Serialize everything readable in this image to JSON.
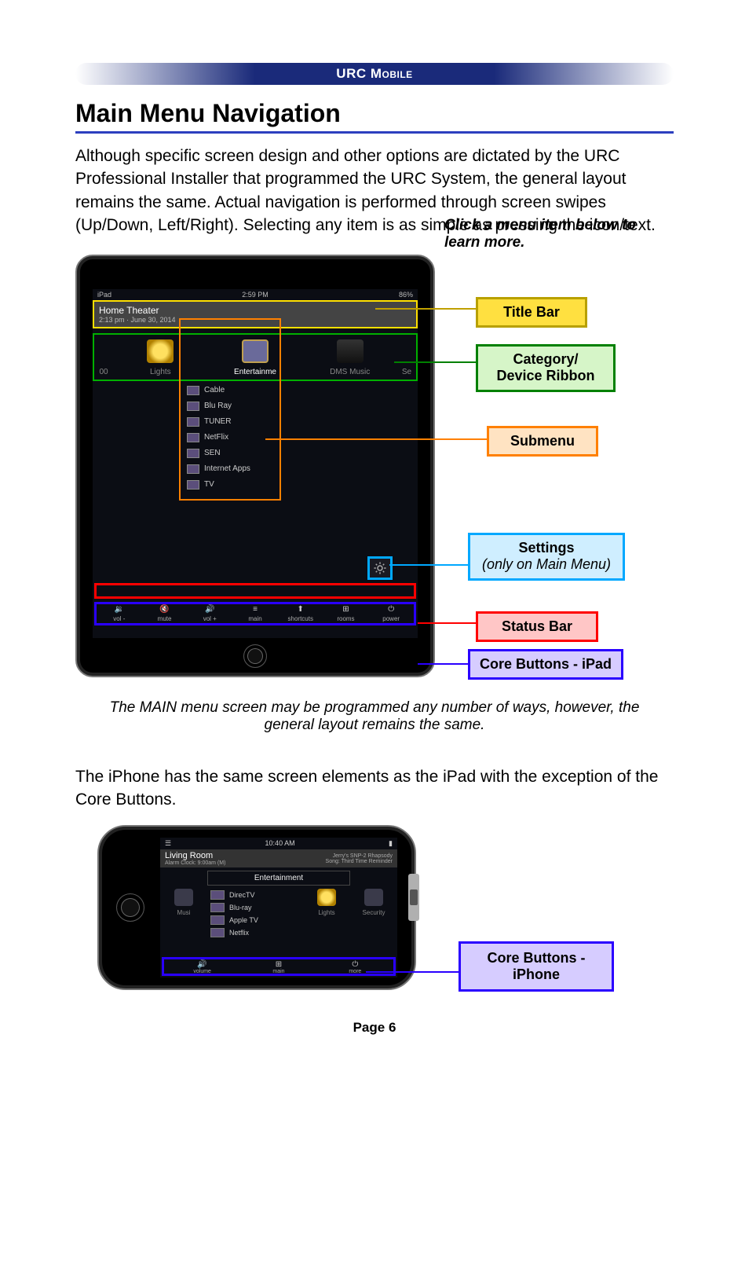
{
  "header": {
    "brand": "URC Mobile"
  },
  "title": "Main Menu Navigation",
  "intro": "Although specific screen design and other options are dictated by the URC Professional Installer that programmed the URC System, the general layout remains the same. Actual navigation is performed through screen swipes (Up/Down, Left/Right). Selecting any item is as simple as pressing the icon/text.",
  "hint": "Click a menu item below to learn more.",
  "ipad": {
    "status_time": "2:59 PM",
    "status_left": "iPad",
    "status_right": "86%",
    "room": "Home Theater",
    "datetime": "2:13 pm  ·  June 30, 2014",
    "ribbon": [
      {
        "label": "Lights"
      },
      {
        "label": "Entertainme"
      },
      {
        "label": "DMS Music"
      }
    ],
    "ribbon_left_edge": "00",
    "ribbon_right_edge": "Se",
    "submenu": [
      "Cable",
      "Blu Ray",
      "TUNER",
      "NetFlix",
      "SEN",
      "Internet Apps",
      "TV"
    ],
    "core": [
      {
        "label": "vol -",
        "glyph": "🔉"
      },
      {
        "label": "mute",
        "glyph": "🔇"
      },
      {
        "label": "vol +",
        "glyph": "🔊"
      },
      {
        "label": "main",
        "glyph": "≡"
      },
      {
        "label": "shortcuts",
        "glyph": "⬆"
      },
      {
        "label": "rooms",
        "glyph": "⊞"
      },
      {
        "label": "power",
        "glyph": "⏻"
      }
    ]
  },
  "legend": {
    "title_bar": "Title Bar",
    "category": "Category/\nDevice Ribbon",
    "submenu": "Submenu",
    "settings_title": "Settings",
    "settings_note": "(only on Main Menu)",
    "status_bar": "Status Bar",
    "core_ipad": "Core Buttons - iPad",
    "core_iphone": "Core Buttons - iPhone"
  },
  "caption": "The MAIN menu screen may be programmed any number of ways, however, the general layout remains the same.",
  "para2": "The iPhone has the same screen elements as the iPad with the exception of the Core Buttons.",
  "iphone": {
    "status_time": "10:40 AM",
    "room": "Living Room",
    "alarm": "Alarm Clock: 9:00am (M)",
    "np1": "Jerry's SNP-2 Rhapsody",
    "np2": "Song: Third Time Reminder",
    "ent_label": "Entertainment",
    "sides": [
      "Musi",
      "Lights",
      "Security"
    ],
    "menu": [
      "DirecTV",
      "Blu-ray",
      "Apple TV",
      "Netflix"
    ],
    "core": [
      {
        "label": "volume",
        "glyph": "🔊"
      },
      {
        "label": "main",
        "glyph": "⊞"
      },
      {
        "label": "more",
        "glyph": "⏻"
      }
    ]
  },
  "page_label": "Page 6"
}
